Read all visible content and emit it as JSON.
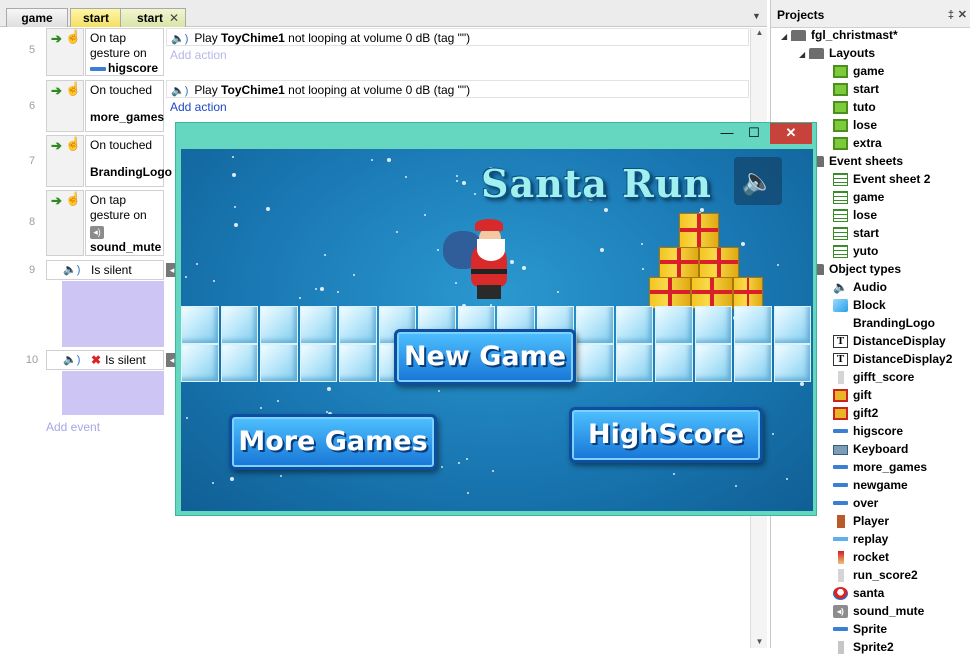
{
  "tabs": [
    {
      "label": "game"
    },
    {
      "label": "start"
    },
    {
      "label": "start",
      "close": "✕"
    }
  ],
  "tab_dropdown": "▼",
  "events": [
    {
      "num": "5",
      "cond_line1": "On tap gesture on",
      "cond_obj": "higscore",
      "action_prefix": "Play ",
      "action_obj": "ToyChime1",
      "action_rest": " not looping at volume 0 dB (tag \"\")",
      "add_action": "Add action"
    },
    {
      "num": "6",
      "cond_line1": "On touched",
      "cond_obj": "more_games",
      "action_prefix": "Play ",
      "action_obj": "ToyChime1",
      "action_rest": " not looping at volume 0 dB (tag \"\")",
      "add_action": "Add action"
    },
    {
      "num": "7",
      "cond_line1": "On touched",
      "cond_obj": "BrandingLogo"
    },
    {
      "num": "8",
      "cond_line1": "On tap gesture on",
      "cond_obj": "sound_mute"
    },
    {
      "num": "9",
      "cond": "Is silent"
    },
    {
      "num": "10",
      "cond": "Is silent"
    }
  ],
  "add_event": "Add event",
  "projects": {
    "title": "Projects",
    "pin": "‡",
    "close": "✕",
    "root": "fgl_christmast*",
    "layouts_folder": "Layouts",
    "layouts": [
      "game",
      "start",
      "tuto",
      "lose",
      "extra"
    ],
    "sheets_folder": "Event sheets",
    "sheets": [
      "Event sheet 2",
      "game",
      "lose",
      "start",
      "yuto"
    ],
    "objects_folder": "Object types",
    "objects": [
      {
        "name": "Audio",
        "icon": "audio-icon"
      },
      {
        "name": "Block",
        "icon": "block-icon"
      },
      {
        "name": "BrandingLogo",
        "icon": "blank"
      },
      {
        "name": "DistanceDisplay",
        "icon": "text-icon"
      },
      {
        "name": "DistanceDisplay2",
        "icon": "text-icon"
      },
      {
        "name": "gifft_score",
        "icon": "score-icon"
      },
      {
        "name": "gift",
        "icon": "gift-icon"
      },
      {
        "name": "gift2",
        "icon": "gift-icon"
      },
      {
        "name": "higscore",
        "icon": "bar-icon"
      },
      {
        "name": "Keyboard",
        "icon": "keyboard-icon"
      },
      {
        "name": "more_games",
        "icon": "bar-icon"
      },
      {
        "name": "newgame",
        "icon": "bar-icon"
      },
      {
        "name": "over",
        "icon": "bar-icon"
      },
      {
        "name": "Player",
        "icon": "player-icon"
      },
      {
        "name": "replay",
        "icon": "replay-icon"
      },
      {
        "name": "rocket",
        "icon": "rocket-icon"
      },
      {
        "name": "run_score2",
        "icon": "score-icon"
      },
      {
        "name": "santa",
        "icon": "santa-icon"
      },
      {
        "name": "sound_mute",
        "icon": "sound-icon"
      },
      {
        "name": "Sprite",
        "icon": "bar-icon"
      },
      {
        "name": "Sprite2",
        "icon": "smallgray-icon"
      }
    ]
  },
  "preview": {
    "min": "—",
    "max": "☐",
    "close": "✕",
    "title": "Santa Run",
    "sound_glyph": "🔈",
    "new_game": "New Game",
    "more_games": "More Games",
    "highscore": "HighScore"
  }
}
